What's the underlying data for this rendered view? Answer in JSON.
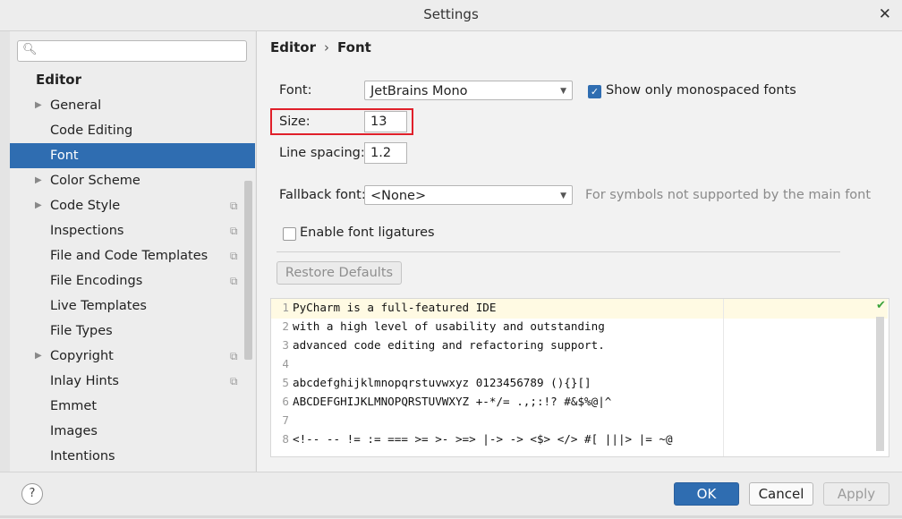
{
  "window": {
    "title": "Settings"
  },
  "search": {
    "placeholder": "",
    "value": ""
  },
  "sidebar": {
    "header": "Editor",
    "items": [
      {
        "label": "General"
      },
      {
        "label": "Code Editing"
      },
      {
        "label": "Font"
      },
      {
        "label": "Color Scheme"
      },
      {
        "label": "Code Style"
      },
      {
        "label": "Inspections"
      },
      {
        "label": "File and Code Templates"
      },
      {
        "label": "File Encodings"
      },
      {
        "label": "Live Templates"
      },
      {
        "label": "File Types"
      },
      {
        "label": "Copyright"
      },
      {
        "label": "Inlay Hints"
      },
      {
        "label": "Emmet"
      },
      {
        "label": "Images"
      },
      {
        "label": "Intentions"
      }
    ]
  },
  "breadcrumb": {
    "parent": "Editor",
    "sep": "›",
    "current": "Font"
  },
  "font": {
    "font_label": "Font:",
    "font_value": "JetBrains Mono",
    "monospaced_label": "Show only monospaced fonts",
    "size_label": "Size:",
    "size_value": "13",
    "spacing_label": "Line spacing:",
    "spacing_value": "1.2",
    "fallback_label": "Fallback font:",
    "fallback_value": "<None>",
    "fallback_hint": "For symbols not supported by the main font",
    "ligatures_label": "Enable font ligatures",
    "restore_label": "Restore Defaults"
  },
  "preview": {
    "lines": [
      {
        "n": "1",
        "text": "PyCharm is a full-featured IDE"
      },
      {
        "n": "2",
        "text": "with a high level of usability and outstanding"
      },
      {
        "n": "3",
        "text": "advanced code editing and refactoring support."
      },
      {
        "n": "4",
        "text": ""
      },
      {
        "n": "5",
        "text": "abcdefghijklmnopqrstuvwxyz 0123456789 (){}[]"
      },
      {
        "n": "6",
        "text": "ABCDEFGHIJKLMNOPQRSTUVWXYZ +-*/= .,;:!? #&$%@|^"
      },
      {
        "n": "7",
        "text": ""
      },
      {
        "n": "8",
        "text": "<!-- -- != := === >= >- >=> |-> -> <$> </> #[ |||> |= ~@"
      }
    ]
  },
  "buttons": {
    "help": "?",
    "ok": "OK",
    "cancel": "Cancel",
    "apply": "Apply"
  },
  "colors": {
    "accent": "#2f6db1",
    "highlight": "#e0202a"
  },
  "icons": {
    "close": "close-icon",
    "search": "search-icon",
    "copy": "copy-settings-icon",
    "check": "checkmark-icon"
  }
}
